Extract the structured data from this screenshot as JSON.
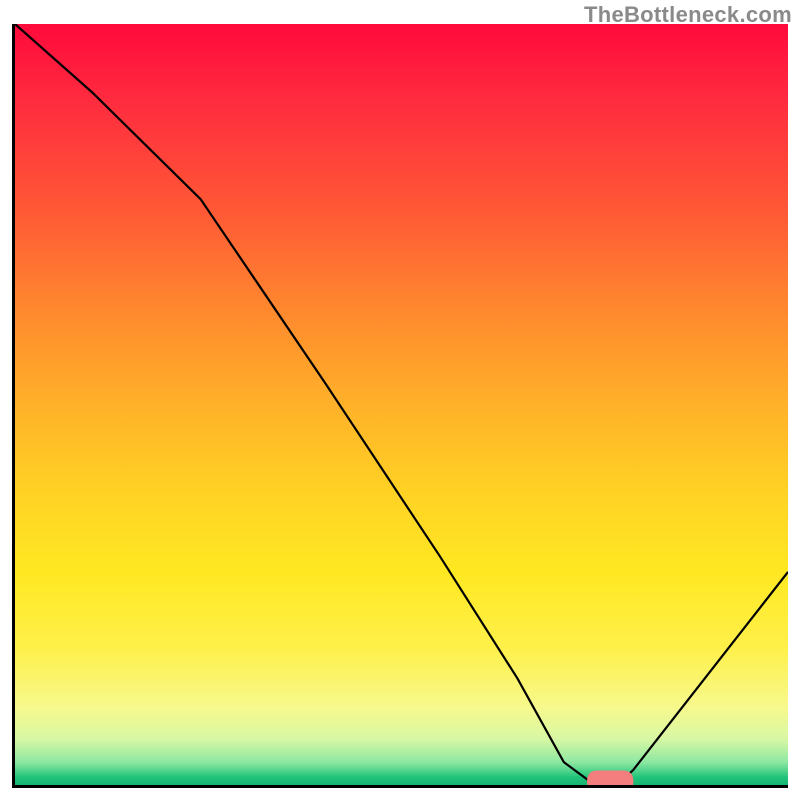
{
  "watermark": "TheBottleneck.com",
  "colors": {
    "top": "#ff0a3c",
    "mid": "#ffd324",
    "bottom": "#14b573",
    "axis": "#000000",
    "curve": "#000000",
    "marker": "#f47d7d"
  },
  "chart_data": {
    "type": "line",
    "title": "",
    "xlabel": "",
    "ylabel": "",
    "xlim": [
      0,
      100
    ],
    "ylim": [
      0,
      100
    ],
    "grid": false,
    "legend": false,
    "series": [
      {
        "name": "bottleneck-curve",
        "x": [
          0,
          10,
          24,
          40,
          55,
          65,
          71,
          75,
          78,
          80,
          100
        ],
        "y": [
          100,
          91,
          77,
          53,
          30,
          14,
          3,
          0,
          0,
          2,
          28
        ]
      }
    ],
    "marker": {
      "name": "optimal-range",
      "x_start": 74,
      "x_end": 80,
      "y": 0.5
    },
    "gradient_stops": [
      {
        "pos": 0,
        "color": "#ff0a3c"
      },
      {
        "pos": 10,
        "color": "#ff2b3f"
      },
      {
        "pos": 25,
        "color": "#ff5a35"
      },
      {
        "pos": 38,
        "color": "#ff8a2e"
      },
      {
        "pos": 50,
        "color": "#ffb129"
      },
      {
        "pos": 62,
        "color": "#ffd324"
      },
      {
        "pos": 72,
        "color": "#ffe822"
      },
      {
        "pos": 82,
        "color": "#fff04a"
      },
      {
        "pos": 90,
        "color": "#f6f98e"
      },
      {
        "pos": 94,
        "color": "#d7f7a4"
      },
      {
        "pos": 97,
        "color": "#8de8a1"
      },
      {
        "pos": 99,
        "color": "#20c37a"
      },
      {
        "pos": 100,
        "color": "#14b573"
      }
    ]
  }
}
